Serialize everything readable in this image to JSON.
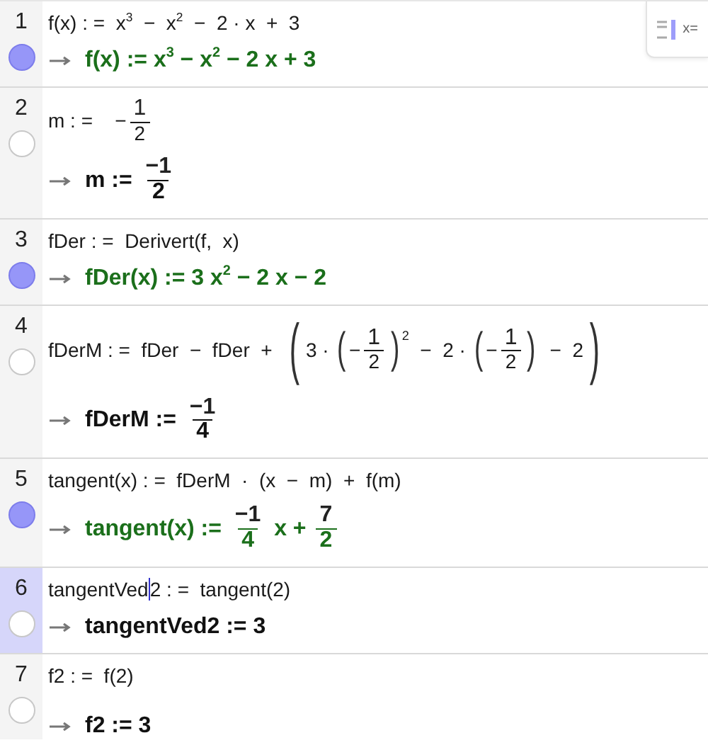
{
  "toolbar": {
    "view_button": {
      "label": "x="
    }
  },
  "rows": [
    {
      "number": "1",
      "visible": true,
      "selected": false,
      "input": [
        {
          "kind": "text",
          "text": "f(x) : =  x$^{3}$  −  x$^{2}$  −  2 · x  +  3"
        }
      ],
      "output": {
        "color": "#1b6f1b",
        "parts": [
          {
            "kind": "text",
            "text": "f(x) := x$^{3}$ − x$^{2}$ − 2 x + 3"
          }
        ]
      }
    },
    {
      "number": "2",
      "visible": false,
      "selected": false,
      "input": [
        {
          "kind": "text",
          "text": "m : =    −"
        },
        {
          "kind": "frac",
          "num": "1",
          "den": "2"
        }
      ],
      "output": {
        "color": "#111111",
        "parts": [
          {
            "kind": "text",
            "text": "m := "
          },
          {
            "kind": "frac",
            "num": "−1",
            "den": "2"
          }
        ]
      }
    },
    {
      "number": "3",
      "visible": true,
      "selected": false,
      "input": [
        {
          "kind": "text",
          "text": "fDer : =  Derivert(f,  x)"
        }
      ],
      "output": {
        "color": "#1b6f1b",
        "parts": [
          {
            "kind": "text",
            "text": "fDer(x) := 3 x$^{2}$ − 2 x − 2"
          }
        ]
      }
    },
    {
      "number": "4",
      "visible": false,
      "selected": false,
      "input": [
        {
          "kind": "text",
          "text": "fDerM : =  fDer  −  fDer  +  "
        },
        {
          "kind": "group",
          "open": "(",
          "close": ")",
          "parts": [
            {
              "kind": "text",
              "text": "3 · "
            },
            {
              "kind": "group",
              "open": "(",
              "close": ")",
              "sup": "2",
              "parts": [
                {
                  "kind": "text",
                  "text": "−"
                },
                {
                  "kind": "frac",
                  "num": "1",
                  "den": "2"
                }
              ]
            },
            {
              "kind": "text",
              "text": "  −  2 · "
            },
            {
              "kind": "group",
              "open": "(",
              "close": ")",
              "parts": [
                {
                  "kind": "text",
                  "text": "−"
                },
                {
                  "kind": "frac",
                  "num": "1",
                  "den": "2"
                }
              ]
            },
            {
              "kind": "text",
              "text": "  −  2"
            }
          ]
        }
      ],
      "output": {
        "color": "#111111",
        "parts": [
          {
            "kind": "text",
            "text": "fDerM := "
          },
          {
            "kind": "frac",
            "num": "−1",
            "den": "4"
          }
        ]
      }
    },
    {
      "number": "5",
      "visible": true,
      "selected": false,
      "input": [
        {
          "kind": "text",
          "text": "tangent(x) : =  fDerM  ·  (x  −  m)  +  f(m)"
        }
      ],
      "output": {
        "color": "#1b6f1b",
        "parts": [
          {
            "kind": "text",
            "text": "tangent(x) := "
          },
          {
            "kind": "frac",
            "num": "−1",
            "den": "4"
          },
          {
            "kind": "text",
            "text": " x + "
          },
          {
            "kind": "frac",
            "num": "7",
            "den": "2"
          }
        ]
      }
    },
    {
      "number": "6",
      "visible": false,
      "selected": true,
      "input": [
        {
          "kind": "text",
          "text": "tangentVed"
        },
        {
          "kind": "cursor"
        },
        {
          "kind": "text",
          "text": "2 : =  tangent(2)"
        }
      ],
      "output": {
        "color": "#111111",
        "parts": [
          {
            "kind": "text",
            "text": "tangentVed2 := 3"
          }
        ]
      }
    },
    {
      "number": "7",
      "visible": false,
      "selected": false,
      "input": [
        {
          "kind": "text",
          "text": "f2 : =  f(2)"
        }
      ],
      "output": {
        "color": "#111111",
        "parts": [
          {
            "kind": "text",
            "text": "f2 := 3"
          }
        ]
      }
    }
  ]
}
